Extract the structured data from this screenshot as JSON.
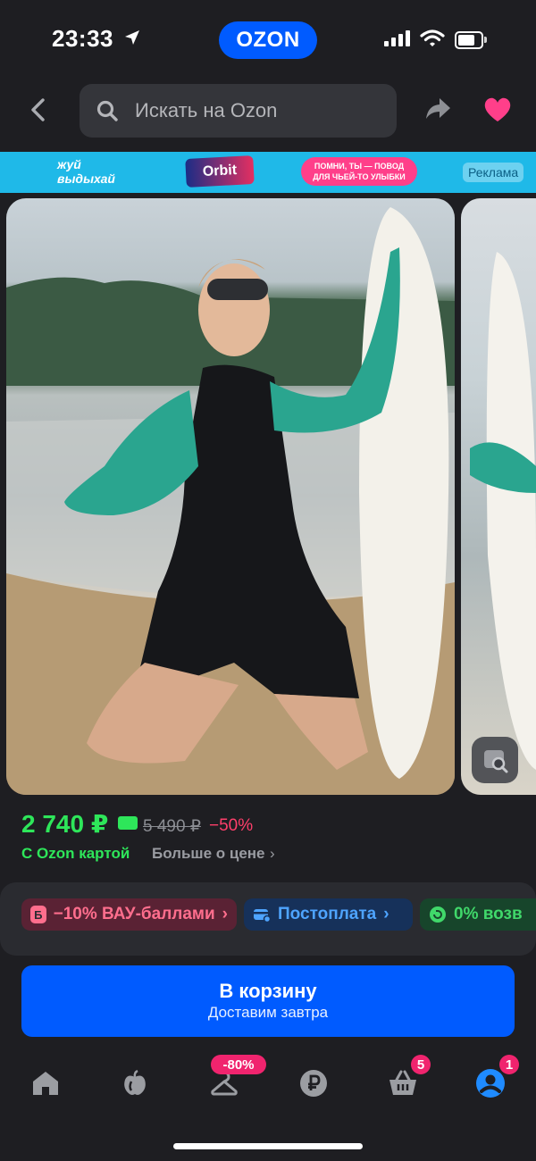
{
  "status_bar": {
    "time": "23:33",
    "brand": "OZON"
  },
  "search": {
    "placeholder": "Искать на Ozon"
  },
  "banner": {
    "left_text_line1": "жуй",
    "left_text_line2": "выдыхай",
    "product_label": "Orbit",
    "promo_line1": "ПОМНИ, ТЫ — ПОВОД",
    "promo_line2": "ДЛЯ ЧЬЕЙ-ТО УЛЫБКИ",
    "ad_label": "Реклама"
  },
  "product": {
    "price": "2 740 ₽",
    "old_price": "5 490 ₽",
    "discount": "−50%",
    "ozon_card_label": "С Ozon картой",
    "more_price_label": "Больше о цене",
    "chevron": "›"
  },
  "offers": [
    {
      "icon_text": "Б",
      "label": "−10% ВАУ-баллами",
      "chevron": "›"
    },
    {
      "icon_text": "",
      "label": "Постоплата",
      "chevron": "›"
    },
    {
      "icon_text": "",
      "label": "0% возв"
    }
  ],
  "cart_button": {
    "title": "В корзину",
    "subtitle": "Доставим завтра"
  },
  "tab_bar": {
    "items": [
      {
        "name": "home",
        "badge": ""
      },
      {
        "name": "fresh",
        "badge": ""
      },
      {
        "name": "sale",
        "badge": "-80%"
      },
      {
        "name": "finance",
        "badge": ""
      },
      {
        "name": "cart",
        "badge": "5"
      },
      {
        "name": "profile",
        "badge": "1"
      }
    ]
  },
  "colors": {
    "brand_blue": "#005bff",
    "price_green": "#2ee65a",
    "discount_red": "#ff3f6b",
    "heart_pink": "#ff3f8a",
    "badge_pink": "#f0246e",
    "background": "#1e1e22"
  }
}
